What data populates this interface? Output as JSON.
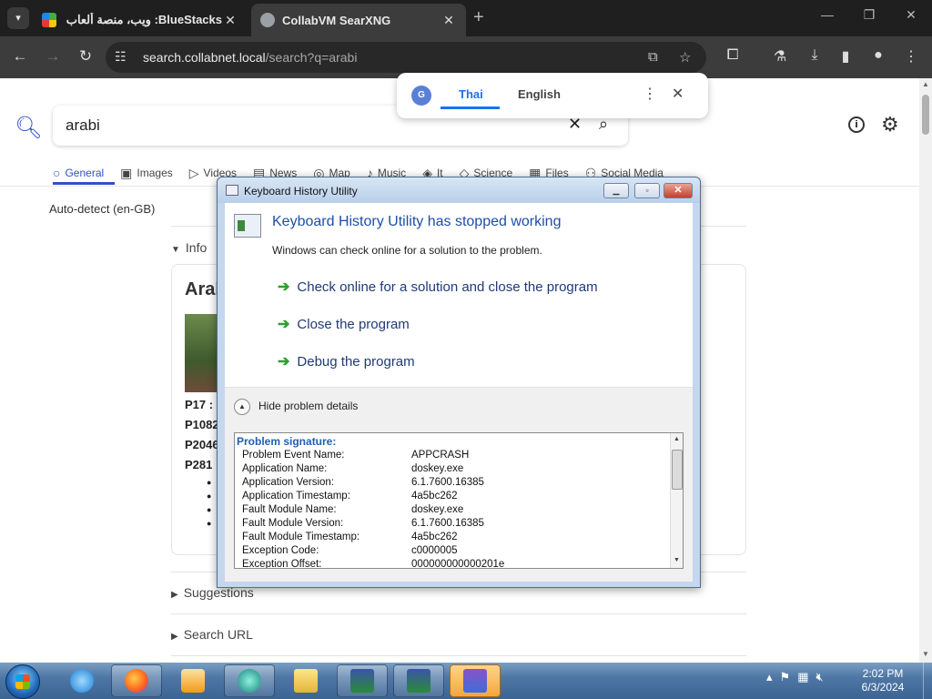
{
  "browser": {
    "tabs": [
      {
        "title": "BlueStacks: ويب، منصة ألعاب سحابية",
        "active": false
      },
      {
        "title": "CollabVM SearXNG",
        "active": true
      }
    ],
    "url_host": "search.collabnet.local",
    "url_path": "/search?q=arabi"
  },
  "translate_popup": {
    "lang_from": "Thai",
    "lang_to": "English"
  },
  "search": {
    "query": "arabi",
    "categories": [
      "General",
      "Images",
      "Videos",
      "News",
      "Map",
      "Music",
      "It",
      "Science",
      "Files",
      "Social Media"
    ],
    "active_category": "General",
    "autodetect": "Auto-detect (en-GB)",
    "sections": {
      "info": "Info",
      "suggestions": "Suggestions",
      "search_url": "Search URL"
    },
    "infobox": {
      "title": "Arab",
      "props": [
        "P17 :",
        "P1082",
        "P2046",
        "P281 :"
      ]
    }
  },
  "dialog": {
    "window_title": "Keyboard History Utility",
    "heading": "Keyboard History Utility has stopped working",
    "subtext": "Windows can check online for a solution to the problem.",
    "options": [
      "Check online for a solution and close the program",
      "Close the program",
      "Debug the program"
    ],
    "details_toggle": "Hide problem details",
    "signature_label": "Problem signature:",
    "signature": [
      {
        "name": "Problem Event Name:",
        "value": "APPCRASH"
      },
      {
        "name": "Application Name:",
        "value": "doskey.exe"
      },
      {
        "name": "Application Version:",
        "value": "6.1.7600.16385"
      },
      {
        "name": "Application Timestamp:",
        "value": "4a5bc262"
      },
      {
        "name": "Fault Module Name:",
        "value": "doskey.exe"
      },
      {
        "name": "Fault Module Version:",
        "value": "6.1.7600.16385"
      },
      {
        "name": "Fault Module Timestamp:",
        "value": "4a5bc262"
      },
      {
        "name": "Exception Code:",
        "value": "c0000005"
      },
      {
        "name": "Exception Offset:",
        "value": "000000000000201e"
      }
    ]
  },
  "taskbar": {
    "time": "2:02 PM",
    "date": "6/3/2024"
  }
}
